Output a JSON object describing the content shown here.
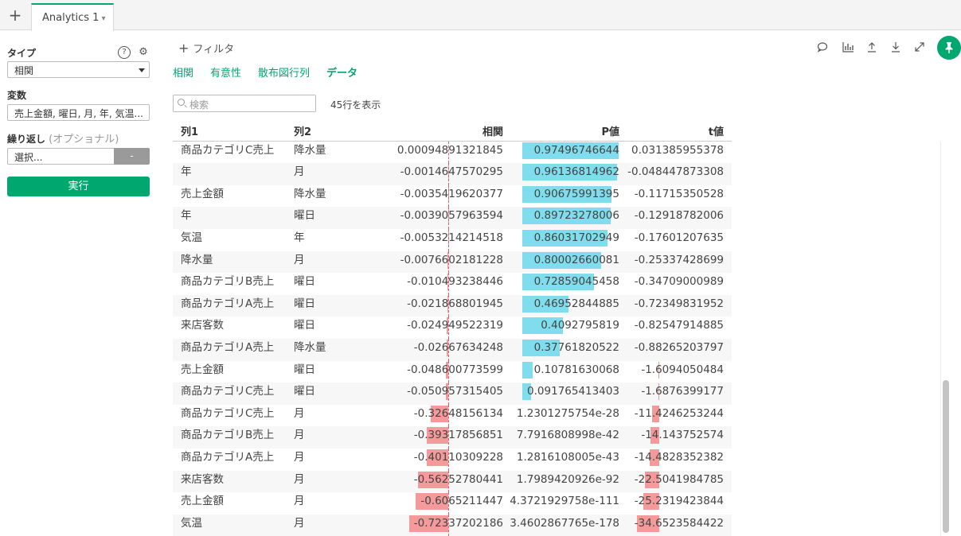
{
  "tabs": {
    "add_label": "+",
    "items": [
      {
        "label": "Analytics 1"
      }
    ]
  },
  "left_panel": {
    "type_label": "タイプ",
    "type_value": "相関",
    "variables_label": "変数",
    "variables_value": "売上金額, 曜日, 月, 年, 気温...",
    "repeat_label": "繰り返し",
    "repeat_optional": "(オプショナル)",
    "repeat_placeholder": "選択...",
    "repeat_button": "-",
    "run_button": "実行"
  },
  "toolbar": {
    "filter_label": "フィルタ"
  },
  "subtabs": [
    "相関",
    "有意性",
    "散布図行列",
    "データ"
  ],
  "search": {
    "placeholder": "検索"
  },
  "row_count": "45行を表示",
  "table": {
    "columns": [
      "列1",
      "列2",
      "相関",
      "P値",
      "t値"
    ],
    "rows": [
      {
        "c1": "商品カテゴリC売上",
        "c2": "降水量",
        "corr": "0.00094891321845",
        "p": "0.97496746644",
        "t": "0.031385955378",
        "corr_v": 0.00094891321845,
        "p_v": 0.97496746644,
        "t_v": 0.031385955378
      },
      {
        "c1": "年",
        "c2": "月",
        "corr": "-0.0014647570295",
        "p": "0.96136814962",
        "t": "-0.048447873308",
        "corr_v": -0.0014647570295,
        "p_v": 0.96136814962,
        "t_v": -0.048447873308
      },
      {
        "c1": "売上金額",
        "c2": "降水量",
        "corr": "-0.0035419620377",
        "p": "0.90675991395",
        "t": "-0.11715350528",
        "corr_v": -0.0035419620377,
        "p_v": 0.90675991395,
        "t_v": -0.11715350528
      },
      {
        "c1": "年",
        "c2": "曜日",
        "corr": "-0.0039057963594",
        "p": "0.89723278006",
        "t": "-0.12918782006",
        "corr_v": -0.0039057963594,
        "p_v": 0.89723278006,
        "t_v": -0.12918782006
      },
      {
        "c1": "気温",
        "c2": "年",
        "corr": "-0.0053214214518",
        "p": "0.86031702949",
        "t": "-0.17601207635",
        "corr_v": -0.0053214214518,
        "p_v": 0.86031702949,
        "t_v": -0.17601207635
      },
      {
        "c1": "降水量",
        "c2": "月",
        "corr": "-0.0076602181228",
        "p": "0.80002660081",
        "t": "-0.25337428699",
        "corr_v": -0.0076602181228,
        "p_v": 0.80002660081,
        "t_v": -0.25337428699
      },
      {
        "c1": "商品カテゴリB売上",
        "c2": "曜日",
        "corr": "-0.010493238446",
        "p": "0.72859045458",
        "t": "-0.34709000989",
        "corr_v": -0.010493238446,
        "p_v": 0.72859045458,
        "t_v": -0.34709000989
      },
      {
        "c1": "商品カテゴリA売上",
        "c2": "曜日",
        "corr": "-0.021868801945",
        "p": "0.46952844885",
        "t": "-0.72349831952",
        "corr_v": -0.021868801945,
        "p_v": 0.46952844885,
        "t_v": -0.72349831952
      },
      {
        "c1": "来店客数",
        "c2": "曜日",
        "corr": "-0.024949522319",
        "p": "0.4092795819",
        "t": "-0.82547914885",
        "corr_v": -0.024949522319,
        "p_v": 0.4092795819,
        "t_v": -0.82547914885
      },
      {
        "c1": "商品カテゴリA売上",
        "c2": "降水量",
        "corr": "-0.02667634248",
        "p": "0.37761820522",
        "t": "-0.88265203797",
        "corr_v": -0.02667634248,
        "p_v": 0.37761820522,
        "t_v": -0.88265203797
      },
      {
        "c1": "売上金額",
        "c2": "曜日",
        "corr": "-0.048600773599",
        "p": "0.10781630068",
        "t": "-1.6094050484",
        "corr_v": -0.048600773599,
        "p_v": 0.10781630068,
        "t_v": -1.6094050484
      },
      {
        "c1": "商品カテゴリC売上",
        "c2": "曜日",
        "corr": "-0.050957315405",
        "p": "0.091765413403",
        "t": "-1.6876399177",
        "corr_v": -0.050957315405,
        "p_v": 0.091765413403,
        "t_v": -1.6876399177
      },
      {
        "c1": "商品カテゴリC売上",
        "c2": "月",
        "corr": "-0.32648156134",
        "p": "1.2301275754e-28",
        "t": "-11.4246253244",
        "corr_v": -0.32648156134,
        "p_v": 1.2301275754e-28,
        "t_v": -11.4246253244
      },
      {
        "c1": "商品カテゴリB売上",
        "c2": "月",
        "corr": "-0.39317856851",
        "p": "7.7916808998e-42",
        "t": "-14.143752574",
        "corr_v": -0.39317856851,
        "p_v": 7.7916808998e-42,
        "t_v": -14.143752574
      },
      {
        "c1": "商品カテゴリA売上",
        "c2": "月",
        "corr": "-0.40110309228",
        "p": "1.2816108005e-43",
        "t": "-14.4828352382",
        "corr_v": -0.40110309228,
        "p_v": 1.2816108005e-43,
        "t_v": -14.4828352382
      },
      {
        "c1": "来店客数",
        "c2": "月",
        "corr": "-0.56252780441",
        "p": "1.7989420926e-92",
        "t": "-22.5041984785",
        "corr_v": -0.56252780441,
        "p_v": 1.7989420926e-92,
        "t_v": -22.5041984785
      },
      {
        "c1": "売上金額",
        "c2": "月",
        "corr": "-0.6065211447",
        "p": "4.3721929758e-111",
        "t": "-25.2319423844",
        "corr_v": -0.6065211447,
        "p_v": 4.3721929758e-111,
        "t_v": -25.2319423844
      },
      {
        "c1": "気温",
        "c2": "月",
        "corr": "-0.72337202186",
        "p": "3.4602867765e-178",
        "t": "-34.6523584422",
        "corr_v": -0.72337202186,
        "p_v": 3.4602867765e-178,
        "t_v": -34.6523584422
      }
    ]
  }
}
